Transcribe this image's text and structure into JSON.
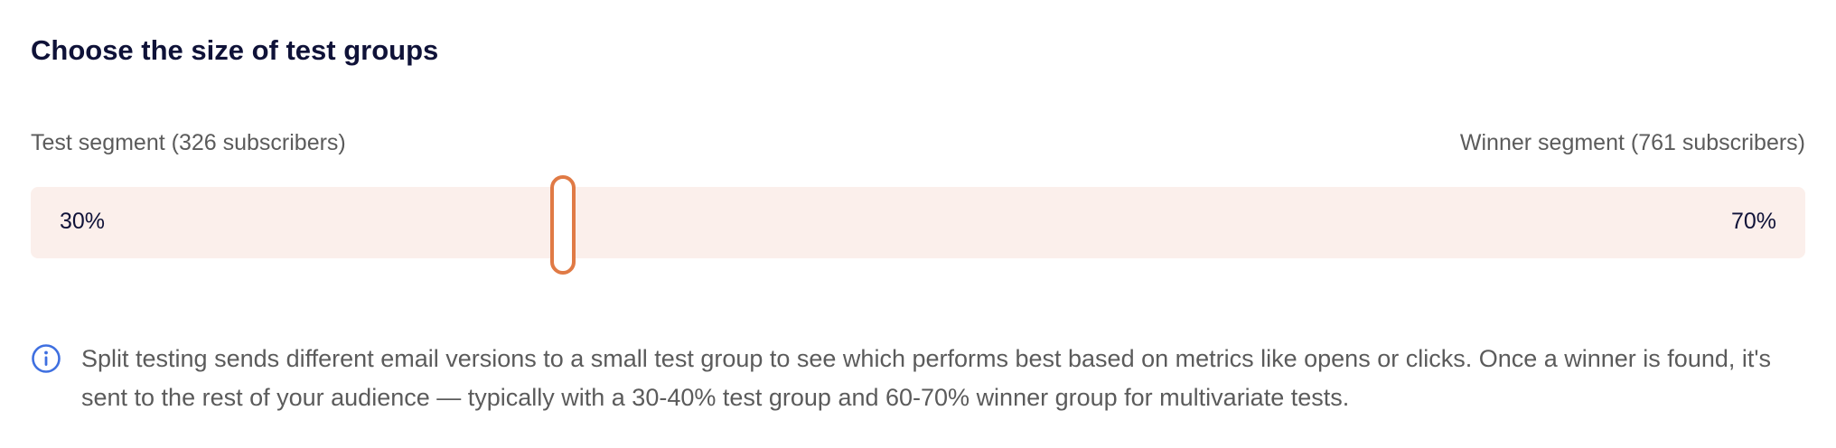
{
  "heading": "Choose the size of test groups",
  "segments": {
    "test_label": "Test segment (326 subscribers)",
    "winner_label": "Winner segment (761 subscribers)",
    "test_percent_label": "30%",
    "winner_percent_label": "70%",
    "split_fraction": 0.3
  },
  "colors": {
    "track": "#fbefeb",
    "handle_border": "#e07a45",
    "info_icon": "#3e6fe0",
    "heading": "#0f1238"
  },
  "info": {
    "icon": "info-icon",
    "text": "Split testing sends different email versions to a small test group to see which performs best based on metrics like opens or clicks. Once a winner is found, it's sent to the rest of your audience — typically with a 30-40% test group and 60-70% winner group for multivariate tests."
  }
}
